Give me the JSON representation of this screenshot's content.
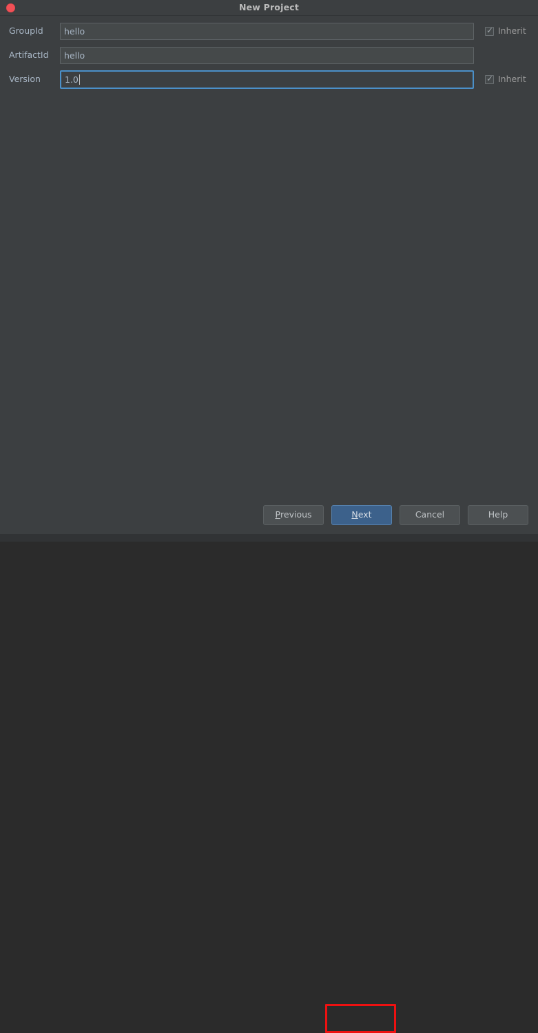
{
  "window": {
    "title": "New Project",
    "close_button": "close-dot"
  },
  "form": {
    "rows": [
      {
        "label": "GroupId",
        "value": "hello",
        "focused": false,
        "has_inherit": true,
        "inherit_label": "Inherit",
        "inherit_checked": true
      },
      {
        "label": "ArtifactId",
        "value": "hello",
        "focused": false,
        "has_inherit": false,
        "inherit_label": "",
        "inherit_checked": false
      },
      {
        "label": "Version",
        "value": "1.0",
        "focused": true,
        "has_inherit": true,
        "inherit_label": "Inherit",
        "inherit_checked": true
      }
    ]
  },
  "buttons": {
    "previous": {
      "mnemonic": "P",
      "rest": "revious"
    },
    "next": {
      "mnemonic": "N",
      "rest": "ext"
    },
    "cancel": {
      "label": "Cancel"
    },
    "help": {
      "label": "Help"
    }
  },
  "colors": {
    "dialog_background": "#3c3f41",
    "input_background": "#45494a",
    "focus_border": "#4b90c9",
    "default_button": "#3c618b",
    "annotation": "#ee1111",
    "close_dot": "#f25056",
    "label_text": "#a9b7c6"
  }
}
